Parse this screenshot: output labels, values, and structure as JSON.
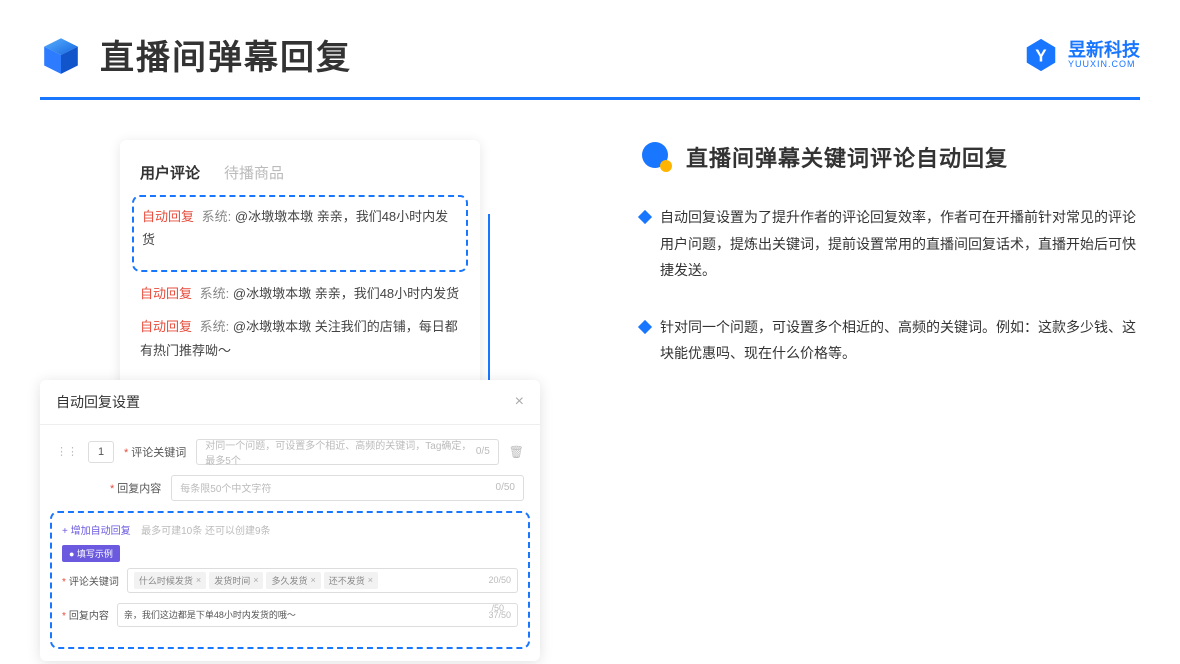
{
  "header": {
    "title": "直播间弹幕回复",
    "brand": "昱新科技",
    "url": "YUUXIN.COM"
  },
  "card1": {
    "tab1": "用户评论",
    "tab2": "待播商品",
    "row1_tag": "自动回复",
    "row1_sys": "系统:",
    "row1_txt": "@冰墩墩本墩 亲亲，我们48小时内发货",
    "row2_tag": "自动回复",
    "row2_sys": "系统:",
    "row2_txt": "@冰墩墩本墩 亲亲，我们48小时内发货",
    "row3_tag": "自动回复",
    "row3_sys": "系统:",
    "row3_txt": "@冰墩墩本墩 关注我们的店铺，每日都有热门推荐呦～"
  },
  "card2": {
    "title": "自动回复设置",
    "num": "1",
    "label_kw": "评论关键词",
    "ph_kw": "对同一个问题，可设置多个相近、高频的关键词，Tag确定，最多5个",
    "cnt_kw": "0/5",
    "label_reply": "回复内容",
    "ph_reply": "每条限50个中文字符",
    "cnt_reply": "0/50",
    "add": "+ 增加自动回复",
    "limit": "最多可建10条 还可以创建9条",
    "badge": "● 填写示例",
    "ex_label_kw": "评论关键词",
    "tag1": "什么时候发货",
    "tag2": "发货时间",
    "tag3": "多久发货",
    "tag4": "还不发货",
    "cnt_ex_kw": "20/50",
    "ex_label_reply": "回复内容",
    "ex_reply": "亲，我们这边都是下单48小时内发货的哦～",
    "cnt_ex_reply": "37/50",
    "float_cnt": "/50"
  },
  "right": {
    "title": "直播间弹幕关键词评论自动回复",
    "b1": "自动回复设置为了提升作者的评论回复效率，作者可在开播前针对常见的评论用户问题，提炼出关键词，提前设置常用的直播间回复话术，直播开始后可快捷发送。",
    "b2": "针对同一个问题，可设置多个相近的、高频的关键词。例如：这款多少钱、这块能优惠吗、现在什么价格等。"
  }
}
